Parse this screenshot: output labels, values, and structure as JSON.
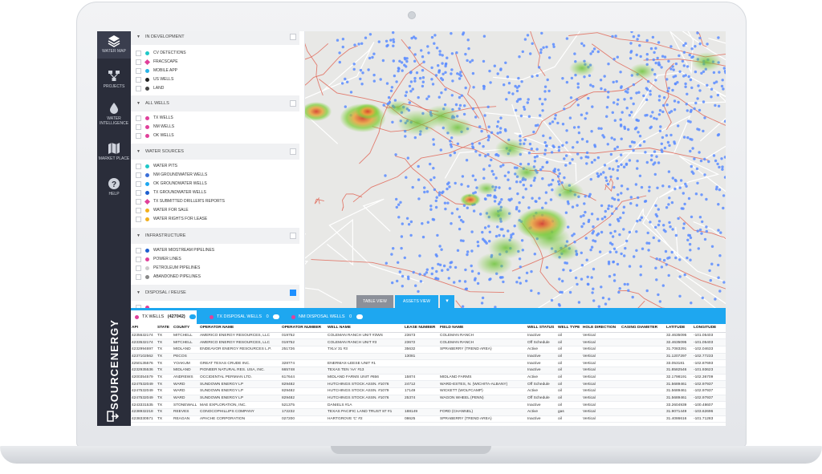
{
  "colors": {
    "accent": "#1ea7f0",
    "nav_bg": "#2a2d3a",
    "map_bg": "#e8e8e6",
    "well_dot": "#5b8cff",
    "fault_line": "#e06a5a",
    "heat_low": "#7fcf3a",
    "heat_high": "#d8432f"
  },
  "nav": {
    "items": [
      {
        "label": "WATER MAP",
        "icon": "layers-icon"
      },
      {
        "label": "PROJECTS",
        "icon": "network-icon"
      },
      {
        "label": "WATER INTELLIGENCE",
        "icon": "water-drop-icon"
      },
      {
        "label": "MARKET PLACE",
        "icon": "map-icon"
      },
      {
        "label": "HELP",
        "icon": "help-icon"
      }
    ],
    "brand": "SOURCENERGY",
    "logout_icon": "logout-icon"
  },
  "layers": {
    "sections": [
      {
        "title": "IN DEVELOPMENT",
        "checked": false,
        "items": [
          {
            "label": "CV DETECTIONS",
            "color": "#1fc8c8"
          },
          {
            "label": "FRACSCAPE",
            "color": "#e0409a"
          },
          {
            "label": "MOBILE APP",
            "color": "#28b4e8"
          },
          {
            "label": "US WELLS",
            "color": "#222222"
          },
          {
            "label": "LAND",
            "color": "#444444"
          }
        ]
      },
      {
        "title": "ALL WELLS",
        "checked": false,
        "items": [
          {
            "label": "TX WELLS",
            "color": "#e0409a"
          },
          {
            "label": "NM WELLS",
            "color": "#e0409a"
          },
          {
            "label": "OK WELLS",
            "color": "#e0409a"
          }
        ]
      },
      {
        "title": "WATER SOURCES",
        "checked": false,
        "items": [
          {
            "label": "WATER PITS",
            "color": "#1fc8c8"
          },
          {
            "label": "NM GROUNDWATER WELLS",
            "color": "#3a6fd8"
          },
          {
            "label": "OK GROUNDWATER WELLS",
            "color": "#1ea7f0"
          },
          {
            "label": "TX GROUNDWATER WELLS",
            "color": "#1e5fd0"
          },
          {
            "label": "TX SUBMITTED DRILLER'S REPORTS",
            "color": "#e0409a"
          },
          {
            "label": "WATER FOR SALE",
            "color": "#f2b01e"
          },
          {
            "label": "WATER RIGHTS FOR LEASE",
            "color": "#f2b01e"
          }
        ]
      },
      {
        "title": "INFRASTRUCTURE",
        "checked": false,
        "items": [
          {
            "label": "WATER MIDSTREAM PIPELINES",
            "color": "#1e5fd0"
          },
          {
            "label": "POWER LINES",
            "color": "#e0409a"
          },
          {
            "label": "PETROLEUM PIPELINES",
            "color": "#cccccc"
          },
          {
            "label": "ABANDONED PIPELINES",
            "color": "#888888"
          }
        ]
      },
      {
        "title": "DISPOSAL / REUSE",
        "checked": true,
        "items": []
      }
    ]
  },
  "map": {
    "tools": [
      "zoom-icon",
      "bookmark-icon",
      "grid-icon",
      "flag-icon",
      "crop-icon",
      "target-icon",
      "share-icon",
      "history-icon"
    ],
    "table_view_label": "TABLE VIEW",
    "assets_view_label": "ASSETS VIEW",
    "collapse_icon": "chevron-down-icon"
  },
  "table": {
    "tabs": [
      {
        "label": "TX WELLS",
        "count": "(427042)",
        "color": "#e0409a"
      },
      {
        "label": "TX DISPOSAL WELLS",
        "count": "0",
        "color": "#e0409a"
      },
      {
        "label": "NM DISPOSAL WELLS",
        "count": "0",
        "color": "#e0409a"
      }
    ],
    "columns": [
      "API",
      "STATE",
      "COUNTY",
      "OPERATOR NAME",
      "OPERATOR NUMBER",
      "WELL NAME",
      "LEASE NUMBER",
      "FIELD NAME",
      "WELL STATUS",
      "WELL TYPE",
      "HOLE DIRECTION",
      "CASING DIAMETER",
      "LATITUDE",
      "LONGITUDE"
    ],
    "rows": [
      [
        "4235532174",
        "TX",
        "MITCHELL",
        "AMERICO ENERGY RESOURCES, LLC",
        "019752",
        "COLEMAN RANCH UNIT #3WS",
        "23673",
        "COLEMAN RANCH",
        "Inactive",
        "oil",
        "Vertical",
        "",
        "32.4635095",
        "-101.05403"
      ],
      [
        "4233532174",
        "TX",
        "MITCHELL",
        "AMERICO ENERGY RESOURCES, LLC",
        "019752",
        "COLEMAN RANCH UNIT #3",
        "23672",
        "COLEMAN RANCH",
        "Off Schedule",
        "oil",
        "Vertical",
        "",
        "32.4635095",
        "-101.05403"
      ],
      [
        "4232994697",
        "TX",
        "MIDLAND",
        "ENDEAVOR ENERGY RESOURCES L.P.",
        "251726",
        "TXLV 31 #3",
        "35632",
        "SPRABERRY (TREND AREA)",
        "Active",
        "oil",
        "Vertical",
        "",
        "31.7083291",
        "-102.04633"
      ],
      [
        "4237102562",
        "TX",
        "PECOS",
        "",
        "",
        "",
        "13081",
        "",
        "Inactive",
        "oil",
        "Vertical",
        "",
        "31.1207297",
        "-102.77233"
      ],
      [
        "4250135576",
        "TX",
        "YOAKUM",
        "GREAT TEXAS CRUDE INC.",
        "328774",
        "ENERMAX-LEESE UNIT #1",
        "",
        "",
        "Inactive",
        "oil",
        "Vertical",
        "",
        "33.053181",
        "-102.87693"
      ],
      [
        "4232935536",
        "TX",
        "MIDLAND",
        "PIONEER NATURAL RES. USA, INC.",
        "665748",
        "TEXAS TEN 'AA' #13",
        "",
        "",
        "Inactive",
        "oil",
        "Vertical",
        "",
        "31.8582546",
        "-101.93623"
      ],
      [
        "4200354579",
        "TX",
        "ANDREWS",
        "OCCIDENTAL PERMIAN LTD.",
        "617644",
        "MIDLAND FARMS UNIT #656",
        "15874",
        "MIDLAND FARMS",
        "Active",
        "oil",
        "Vertical",
        "",
        "32.1798191",
        "-102.36709"
      ],
      [
        "4247532049",
        "TX",
        "WARD",
        "SUNDOWN ENERGY LP",
        "829482",
        "HUTCHINGS STOCK ASSN. #1076",
        "24712",
        "WARD-ESTES, N. (WICHITA-ALBANY)",
        "Off Schedule",
        "oil",
        "Vertical",
        "",
        "31.5689461",
        "-102.97937"
      ],
      [
        "4247532049",
        "TX",
        "WARD",
        "SUNDOWN ENERGY LP",
        "829482",
        "HUTCHINGS STOCK ASSN. #1079",
        "17149",
        "WICKETT (WOLFCAMP)",
        "Active",
        "oil",
        "Vertical",
        "",
        "31.5689461",
        "-102.97937"
      ],
      [
        "4247532049",
        "TX",
        "WARD",
        "SUNDOWN ENERGY LP",
        "829482",
        "HUTCHINGS STOCK ASSN. #1076",
        "25374",
        "WAGON WHEEL (PENN)",
        "Off Schedule",
        "oil",
        "Vertical",
        "",
        "31.5689461",
        "-102.97937"
      ],
      [
        "4243331535",
        "TX",
        "STONEWALL",
        "MAE EXPLORATION, INC.",
        "521375",
        "DANIELS #1A",
        "",
        "",
        "Inactive",
        "oil",
        "Vertical",
        "",
        "33.2604939",
        "-100.48607"
      ],
      [
        "4238932218",
        "TX",
        "REEVES",
        "CONOCOPHILLIPS COMPANY",
        "172232",
        "TEXAS PACIFIC LAND TRUST 87 #1",
        "188149",
        "FORD (CHANNEL)",
        "Active",
        "gas",
        "Vertical",
        "",
        "31.9071449",
        "-103.62696"
      ],
      [
        "4238330571",
        "TX",
        "REAGAN",
        "APACHE CORPORATION",
        "027200",
        "HARTGROVE 'C' #2",
        "08625",
        "SPRABERRY (TREND AREA)",
        "Inactive",
        "oil",
        "Vertical",
        "",
        "31.4086616",
        "-101.71283"
      ]
    ]
  }
}
